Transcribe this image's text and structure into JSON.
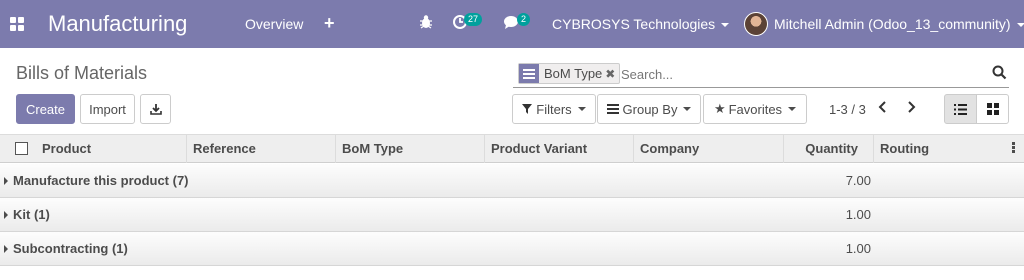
{
  "navbar": {
    "app_title": "Manufacturing",
    "menu": {
      "overview": "Overview"
    },
    "activity_count": "27",
    "message_count": "2",
    "company": "CYBROSYS Technologies",
    "user": "Mitchell Admin (Odoo_13_community)",
    "icons": [
      "apps-icon",
      "plus-icon",
      "bug-icon",
      "activity-icon",
      "chat-icon"
    ]
  },
  "control_panel": {
    "breadcrumb": "Bills of Materials",
    "create_label": "Create",
    "import_label": "Import",
    "search": {
      "facet_label": "BoM Type",
      "placeholder": "Search..."
    },
    "filters_label": "Filters",
    "groupby_label": "Group By",
    "favorites_label": "Favorites",
    "pager": "1-3 / 3"
  },
  "table": {
    "columns": [
      "Product",
      "Reference",
      "BoM Type",
      "Product Variant",
      "Company",
      "Quantity",
      "Routing"
    ],
    "groups": [
      {
        "label": "Manufacture this product (7)",
        "quantity": "7.00"
      },
      {
        "label": "Kit (1)",
        "quantity": "1.00"
      },
      {
        "label": "Subcontracting (1)",
        "quantity": "1.00"
      }
    ]
  },
  "colors": {
    "brand": "#7c7bad",
    "badge": "#00a09d",
    "header_bg": "#eeeeee"
  }
}
